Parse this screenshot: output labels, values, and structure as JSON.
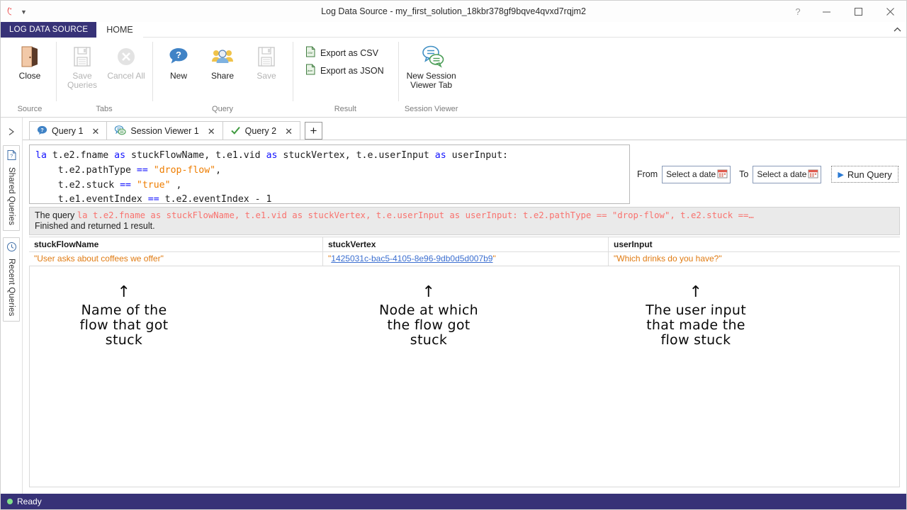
{
  "window": {
    "title": "Log Data Source - my_first_solution_18kbr378gf9bqve4qvxd7rqjm2",
    "help_glyph": "?",
    "minimize_name": "minimize",
    "maximize_name": "maximize",
    "close_name": "close"
  },
  "ribbon": {
    "backstage_tab": "LOG DATA SOURCE",
    "home_tab": "HOME",
    "groups": [
      {
        "label": "Source",
        "buttons": [
          {
            "label": "Close",
            "icon": "door-icon",
            "enabled": true
          }
        ]
      },
      {
        "label": "Tabs",
        "buttons": [
          {
            "label": "Save Queries",
            "icon": "save-disk-icon",
            "enabled": false
          },
          {
            "label": "Cancel All",
            "icon": "cancel-circle-icon",
            "enabled": false
          }
        ]
      },
      {
        "label": "Query",
        "buttons": [
          {
            "label": "New",
            "icon": "question-bubble-icon",
            "enabled": true
          },
          {
            "label": "Share",
            "icon": "people-icon",
            "enabled": true
          },
          {
            "label": "Save",
            "icon": "save-disk-icon",
            "enabled": false
          }
        ]
      },
      {
        "label": "Result",
        "buttons": [
          {
            "label": "Export as CSV",
            "icon": "csv-file-icon",
            "enabled": true
          },
          {
            "label": "Export as JSON",
            "icon": "json-file-icon",
            "enabled": true
          }
        ]
      },
      {
        "label": "Session Viewer",
        "buttons": [
          {
            "label": "New Session Viewer Tab",
            "icon": "chat-bubbles-icon",
            "enabled": true
          }
        ]
      }
    ]
  },
  "rail": {
    "expand_label": "expand-panel",
    "items": [
      {
        "label": "Shared Queries",
        "icon": "shared-query-icon"
      },
      {
        "label": "Recent Queries",
        "icon": "clock-icon"
      }
    ]
  },
  "doc_tabs": {
    "tabs": [
      {
        "label": "Query 1",
        "icon": "blue-question-bubble-icon",
        "close": "✕",
        "active": false
      },
      {
        "label": "Session Viewer 1",
        "icon": "green-chat-bubbles-icon",
        "close": "✕",
        "active": false
      },
      {
        "label": "Query 2",
        "icon": "green-check-icon",
        "close": "✕",
        "active": true
      }
    ],
    "new_tab_glyph": "+"
  },
  "editor": {
    "lines": [
      [
        {
          "t": "la ",
          "c": "kw"
        },
        {
          "t": "t.e2.fname ",
          "c": ""
        },
        {
          "t": "as ",
          "c": "kw"
        },
        {
          "t": "stuckFlowName, t.e1.vid ",
          "c": ""
        },
        {
          "t": "as ",
          "c": "kw"
        },
        {
          "t": "stuckVertex, t.e.userInput ",
          "c": ""
        },
        {
          "t": "as ",
          "c": "kw"
        },
        {
          "t": "userInput:",
          "c": ""
        }
      ],
      [
        {
          "t": "    t.e2.pathType ",
          "c": ""
        },
        {
          "t": "== ",
          "c": "op"
        },
        {
          "t": "\"drop-flow\"",
          "c": "str"
        },
        {
          "t": ",",
          "c": ""
        }
      ],
      [
        {
          "t": "    t.e2.stuck ",
          "c": ""
        },
        {
          "t": "== ",
          "c": "op"
        },
        {
          "t": "\"true\"",
          "c": "str"
        },
        {
          "t": " ,",
          "c": ""
        }
      ],
      [
        {
          "t": "    t.e1.eventIndex ",
          "c": ""
        },
        {
          "t": "== ",
          "c": "op"
        },
        {
          "t": "t.e2.eventIndex - 1",
          "c": ""
        }
      ]
    ]
  },
  "query_controls": {
    "from_label": "From",
    "from_value": "Select a date",
    "to_label": "To",
    "to_value": "Select a date",
    "run_label": "Run Query",
    "run_glyph": "▶",
    "calendar_icon": "calendar-icon"
  },
  "message": {
    "prefix": "The query ",
    "query_echo": "la t.e2.fname as stuckFlowName, t.e1.vid as stuckVertex, t.e.userInput as userInput:        t.e2.pathType == \"drop-flow\",       t.e2.stuck ==…",
    "status": "Finished and returned 1 result."
  },
  "results": {
    "columns": [
      "stuckFlowName",
      "stuckVertex",
      "userInput"
    ],
    "rows": [
      {
        "stuckFlowName": "\"User asks about coffees we offer\"",
        "stuckVertex_quote_open": "\"",
        "stuckVertex_link": "1425031c-bac5-4105-8e96-9db0d5d007b9",
        "stuckVertex_quote_close": "\"",
        "userInput": "\"Which drinks do you have?\""
      }
    ]
  },
  "annotations": [
    {
      "arrow": "↑",
      "line1": "Name of the",
      "line2": "flow that got",
      "line3": "stuck"
    },
    {
      "arrow": "↑",
      "line1": "Node at which",
      "line2": "the flow got",
      "line3": "stuck"
    },
    {
      "arrow": "↑",
      "line1": "The user input",
      "line2": "that made the",
      "line3": "flow stuck"
    }
  ],
  "statusbar": {
    "text": "Ready",
    "indicator_color": "#7fe08a"
  },
  "colors": {
    "brand_purple": "#373277",
    "keyword_blue": "#1414ff",
    "string_orange": "#ee7d00",
    "value_orange": "#e07b12",
    "link_blue": "#3c6fd0",
    "message_red": "#f9726e"
  }
}
